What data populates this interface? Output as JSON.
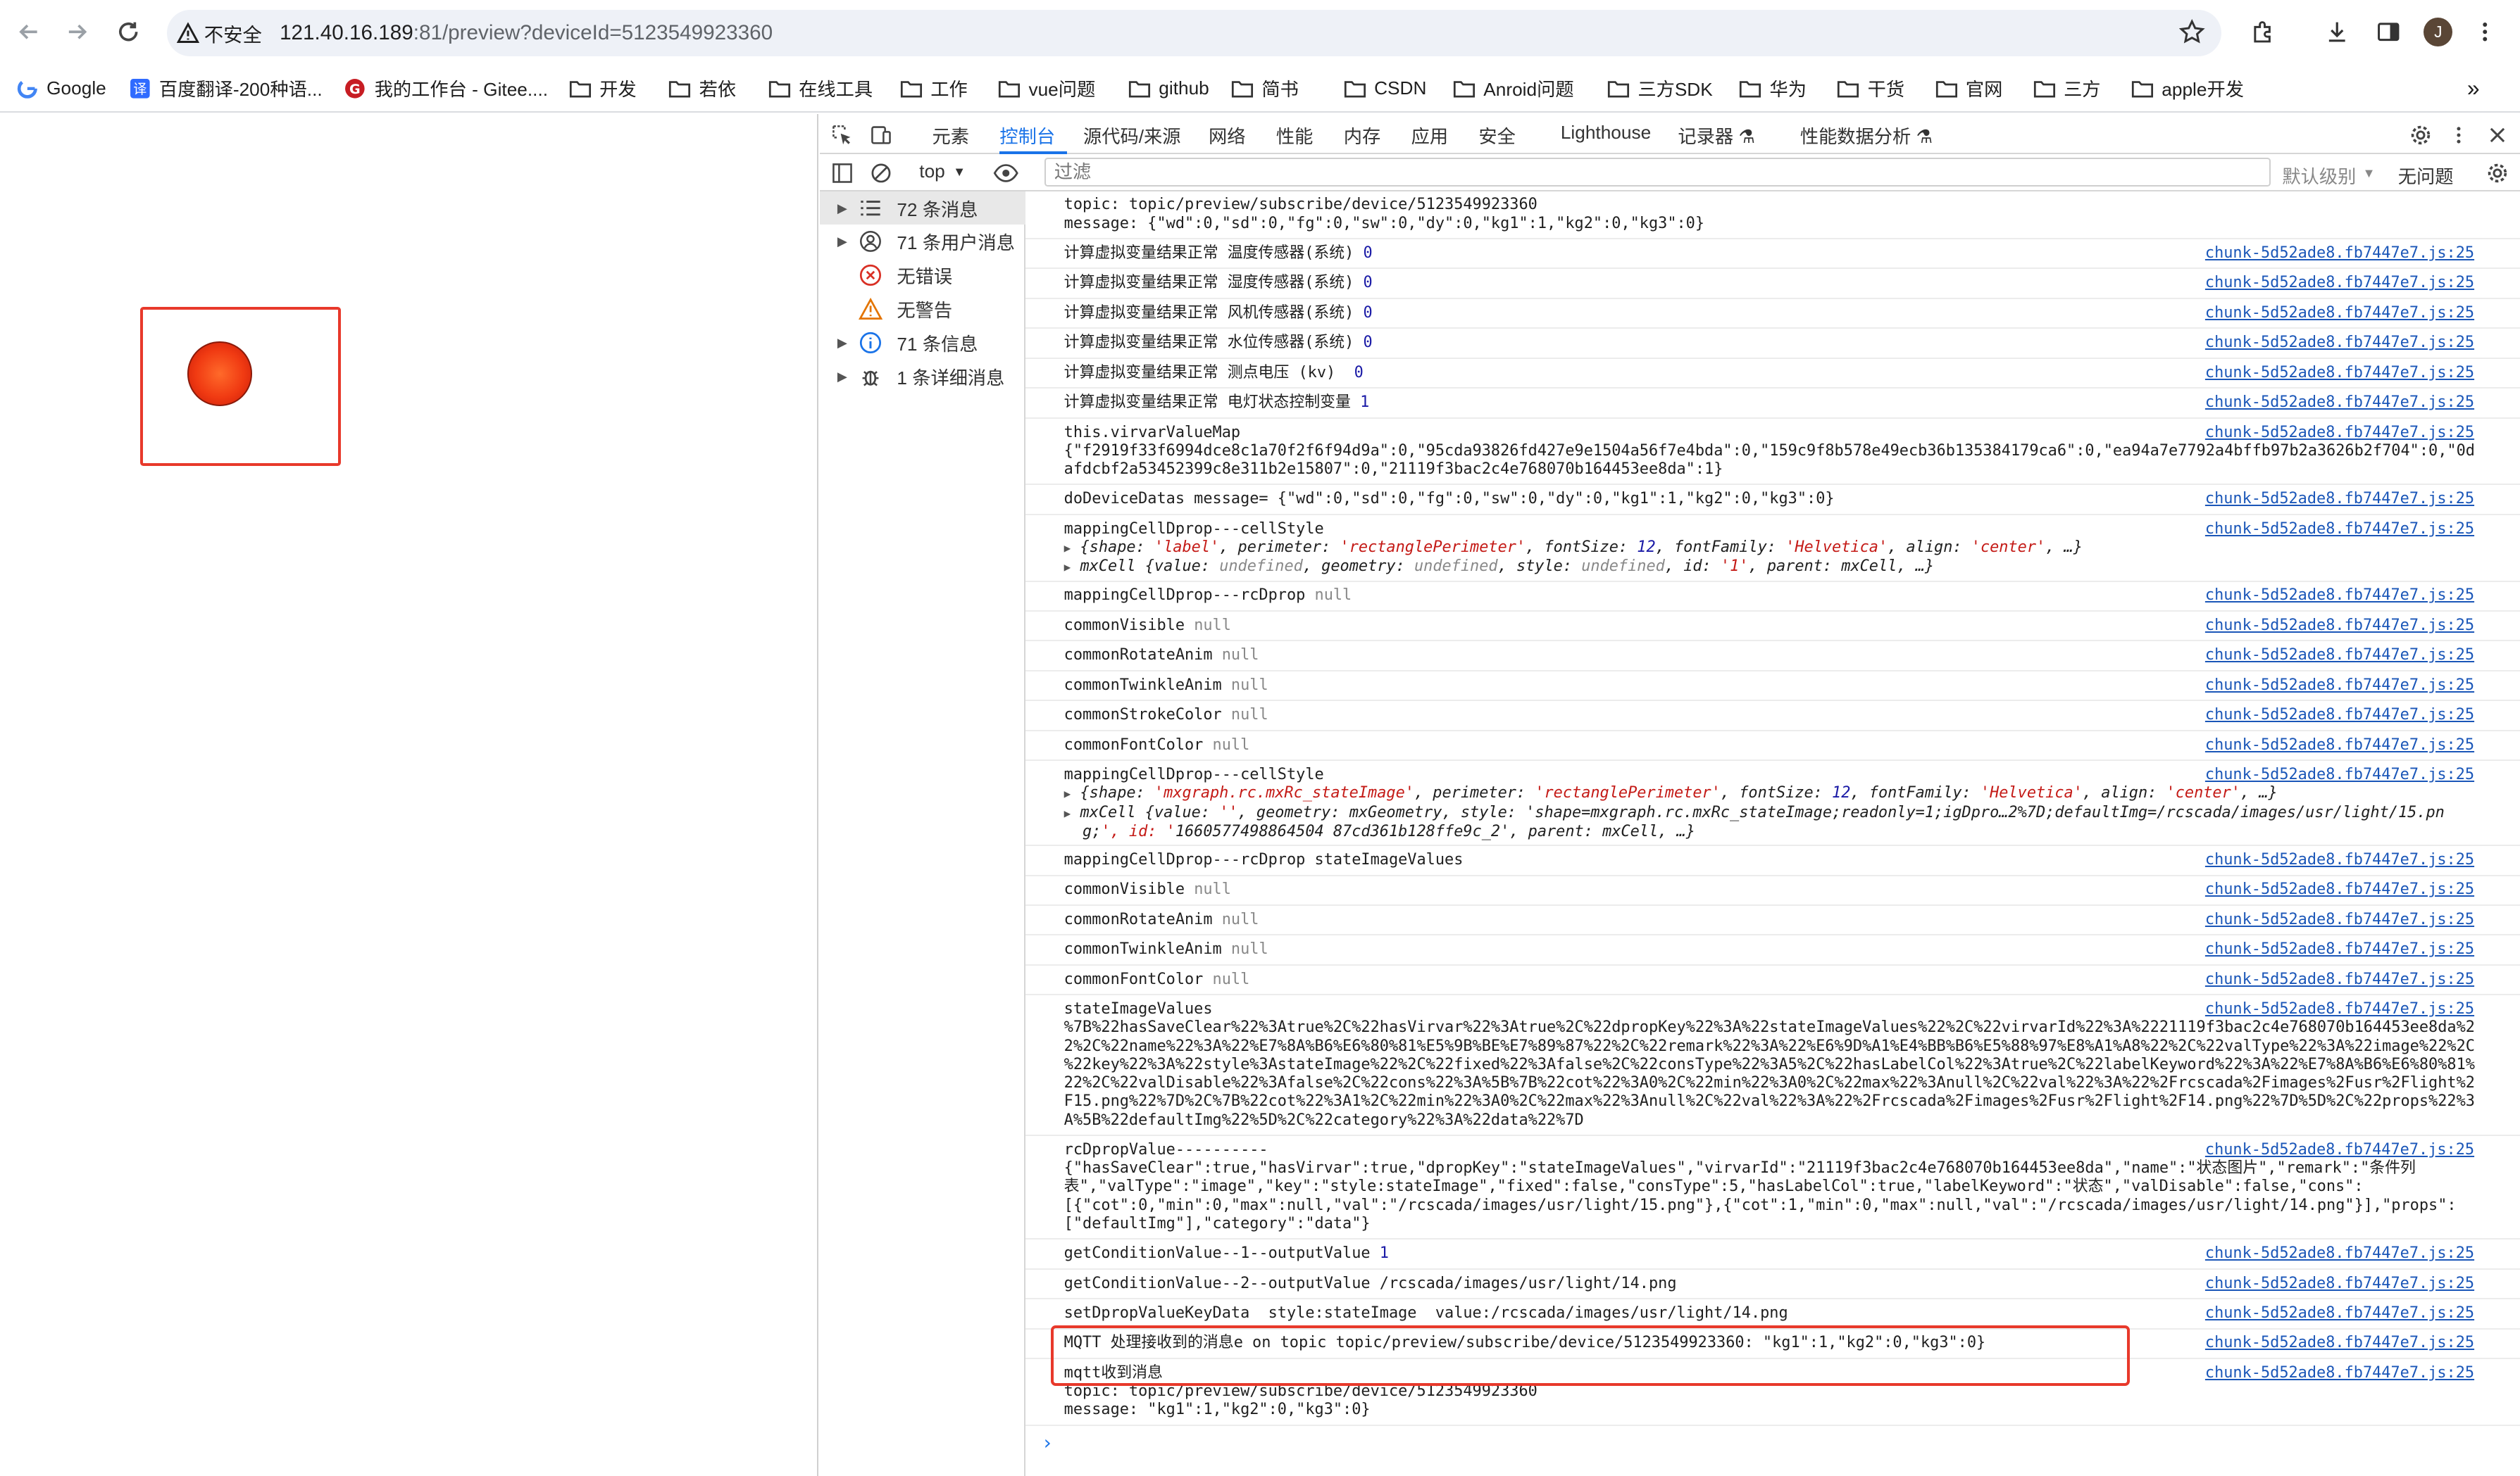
{
  "browser": {
    "security_label": "不安全",
    "url_host": "121.40.16.189",
    "url_rest": ":81/preview?deviceId=5123549923360",
    "avatar_letter": "J"
  },
  "bookmarks": [
    {
      "label": "Google",
      "icon": "google-icon"
    },
    {
      "label": "百度翻译-200种语...",
      "icon": "translate-icon"
    },
    {
      "label": "我的工作台 - Gitee....",
      "icon": "gitee-icon"
    },
    {
      "label": "开发",
      "icon": "folder-icon"
    },
    {
      "label": "若依",
      "icon": "folder-icon"
    },
    {
      "label": "在线工具",
      "icon": "folder-icon"
    },
    {
      "label": "工作",
      "icon": "folder-icon"
    },
    {
      "label": "vue问题",
      "icon": "folder-icon"
    },
    {
      "label": "github",
      "icon": "folder-icon"
    },
    {
      "label": "简书",
      "icon": "folder-icon"
    },
    {
      "label": "CSDN",
      "icon": "folder-icon"
    },
    {
      "label": "Anroid问题",
      "icon": "folder-icon"
    },
    {
      "label": "三方SDK",
      "icon": "folder-icon"
    },
    {
      "label": "华为",
      "icon": "folder-icon"
    },
    {
      "label": "干货",
      "icon": "folder-icon"
    },
    {
      "label": "官网",
      "icon": "folder-icon"
    },
    {
      "label": "三方",
      "icon": "folder-icon"
    },
    {
      "label": "apple开发",
      "icon": "folder-icon"
    }
  ],
  "devtools": {
    "tabs": [
      "元素",
      "控制台",
      "源代码/来源",
      "网络",
      "性能",
      "内存",
      "应用",
      "安全",
      "Lighthouse",
      "记录器 ⚗",
      "性能数据分析 ⚗"
    ],
    "active_tab": "控制台",
    "context": "top",
    "filter_placeholder": "过滤",
    "levels_label": "默认级别",
    "issues_label": "无问题",
    "sidebar": [
      {
        "label": "72 条消息",
        "icon": "list-icon",
        "expandable": true
      },
      {
        "label": "71 条用户消息",
        "icon": "user-icon",
        "expandable": true
      },
      {
        "label": "无错误",
        "icon": "error-icon",
        "expandable": false
      },
      {
        "label": "无警告",
        "icon": "warning-icon",
        "expandable": false
      },
      {
        "label": "71 条信息",
        "icon": "info-icon",
        "expandable": true
      },
      {
        "label": "1 条详细消息",
        "icon": "bug-icon",
        "expandable": true
      }
    ]
  },
  "console": {
    "source": "chunk-5d52ade8.fb7447e7.js:25",
    "messages": [
      {
        "lines": [
          "topic: topic/preview/subscribe/device/5123549923360",
          "message: {\"wd\":0,\"sd\":0,\"fg\":0,\"sw\":0,\"dy\":0,\"kg1\":1,\"kg2\":0,\"kg3\":0}"
        ],
        "source": false
      },
      {
        "text": "计算虚拟变量结果正常 温度传感器(系统)",
        "value": "0"
      },
      {
        "text": "计算虚拟变量结果正常 湿度传感器(系统)",
        "value": "0"
      },
      {
        "text": "计算虚拟变量结果正常 风机传感器(系统)",
        "value": "0"
      },
      {
        "text": "计算虚拟变量结果正常 水位传感器(系统)",
        "value": "0"
      },
      {
        "text": "计算虚拟变量结果正常 测点电压 (kv) ",
        "value": "0"
      },
      {
        "text": "计算虚拟变量结果正常 电灯状态控制变量",
        "value": "1"
      },
      {
        "lines": [
          "this.virvarValueMap",
          "{\"f2919f33f6994dce8c1a70f2f6f94d9a\":0,\"95cda93826fd427e9e1504a56f7e4bda\":0,\"159c9f8b578e49ecb36b135384179ca6\":0,\"ea94a7e7792a4bffb97b2a3626b2f704\":0,\"0d",
          "afdcbf2a53452399c8e311b2e15807\":0,\"21119f3bac2c4e768070b164453ee8da\":1}"
        ]
      },
      {
        "text": "doDeviceDatas message= {\"wd\":0,\"sd\":0,\"fg\":0,\"sw\":0,\"dy\":0,\"kg1\":1,\"kg2\":0,\"kg3\":0}"
      },
      {
        "text": "mappingCellDprop---cellStyle",
        "obj_lines": [
          "{shape: 'label', perimeter: 'rectanglePerimeter', fontSize: 12, fontFamily: 'Helvetica', align: 'center', …}",
          "mxCell {value: undefined, geometry: undefined, style: undefined, id: '1', parent: mxCell, …}"
        ]
      },
      {
        "text": "mappingCellDprop---rcDprop",
        "nul": "null"
      },
      {
        "text": "commonVisible",
        "nul": "null"
      },
      {
        "text": "commonRotateAnim",
        "nul": "null"
      },
      {
        "text": "commonTwinkleAnim",
        "nul": "null"
      },
      {
        "text": "commonStrokeColor",
        "nul": "null"
      },
      {
        "text": "commonFontColor",
        "nul": "null"
      },
      {
        "text": "mappingCellDprop---cellStyle",
        "obj_lines": [
          "{shape: 'mxgraph.rc.mxRc_stateImage', perimeter: 'rectanglePerimeter', fontSize: 12, fontFamily: 'Helvetica', align: 'center', …}",
          "mxCell {value: '', geometry: mxGeometry, style: 'shape=mxgraph.rc.mxRc_stateImage;readonly=1;igDpro…2%7D;defaultImg=/rcscada/images/usr/light/15.pn",
          "g;', id: '1660577498864504 87cd361b128ffe9c_2', parent: mxCell, …}"
        ]
      },
      {
        "text": "mappingCellDprop---rcDprop stateImageValues"
      },
      {
        "text": "commonVisible",
        "nul": "null"
      },
      {
        "text": "commonRotateAnim",
        "nul": "null"
      },
      {
        "text": "commonTwinkleAnim",
        "nul": "null"
      },
      {
        "text": "commonFontColor",
        "nul": "null"
      },
      {
        "lines": [
          "stateImageValues",
          "%7B%22hasSaveClear%22%3Atrue%2C%22hasVirvar%22%3Atrue%2C%22dpropKey%22%3A%22stateImageValues%22%2C%22virvarId%22%3A%2221119f3bac2c4e768070b164453ee8da%2",
          "2%2C%22name%22%3A%22%E7%8A%B6%E6%80%81%E5%9B%BE%E7%89%87%22%2C%22remark%22%3A%22%E6%9D%A1%E4%BB%B6%E5%88%97%E8%A1%A8%22%2C%22valType%22%3A%22image%22%2C",
          "%22key%22%3A%22style%3AstateImage%22%2C%22fixed%22%3Afalse%2C%22consType%22%3A5%2C%22hasLabelCol%22%3Atrue%2C%22labelKeyword%22%3A%22%E7%8A%B6%E6%80%81%",
          "22%2C%22valDisable%22%3Afalse%2C%22cons%22%3A%5B%7B%22cot%22%3A0%2C%22min%22%3A0%2C%22max%22%3Anull%2C%22val%22%3A%22%2Frcscada%2Fimages%2Fusr%2Flight%2",
          "F15.png%22%7D%2C%7B%22cot%22%3A1%2C%22min%22%3A0%2C%22max%22%3Anull%2C%22val%22%3A%22%2Frcscada%2Fimages%2Fusr%2Flight%2F14.png%22%7D%5D%2C%22props%22%3",
          "A%5B%22defaultImg%22%5D%2C%22category%22%3A%22data%22%7D"
        ]
      },
      {
        "lines": [
          "rcDpropValue----------",
          "{\"hasSaveClear\":true,\"hasVirvar\":true,\"dpropKey\":\"stateImageValues\",\"virvarId\":\"21119f3bac2c4e768070b164453ee8da\",\"name\":\"状态图片\",\"remark\":\"条件列",
          "表\",\"valType\":\"image\",\"key\":\"style:stateImage\",\"fixed\":false,\"consType\":5,\"hasLabelCol\":true,\"labelKeyword\":\"状态\",\"valDisable\":false,\"cons\":",
          "[{\"cot\":0,\"min\":0,\"max\":null,\"val\":\"/rcscada/images/usr/light/15.png\"},{\"cot\":1,\"min\":0,\"max\":null,\"val\":\"/rcscada/images/usr/light/14.png\"}],\"props\":",
          "[\"defaultImg\"],\"category\":\"data\"}"
        ]
      },
      {
        "text": "getConditionValue--1--outputValue",
        "value": "1"
      },
      {
        "text": "getConditionValue--2--outputValue /rcscada/images/usr/light/14.png"
      },
      {
        "text": "setDpropValueKeyData  style:stateImage  value:/rcscada/images/usr/light/14.png"
      },
      {
        "text": "MQTT 处理接收到的消息e on topic topic/preview/subscribe/device/5123549923360: \"kg1\":1,\"kg2\":0,\"kg3\":0}"
      },
      {
        "lines": [
          "mqtt收到消息",
          "topic: topic/preview/subscribe/device/5123549923360",
          "message: \"kg1\":1,\"kg2\":0,\"kg3\":0}"
        ]
      }
    ]
  }
}
